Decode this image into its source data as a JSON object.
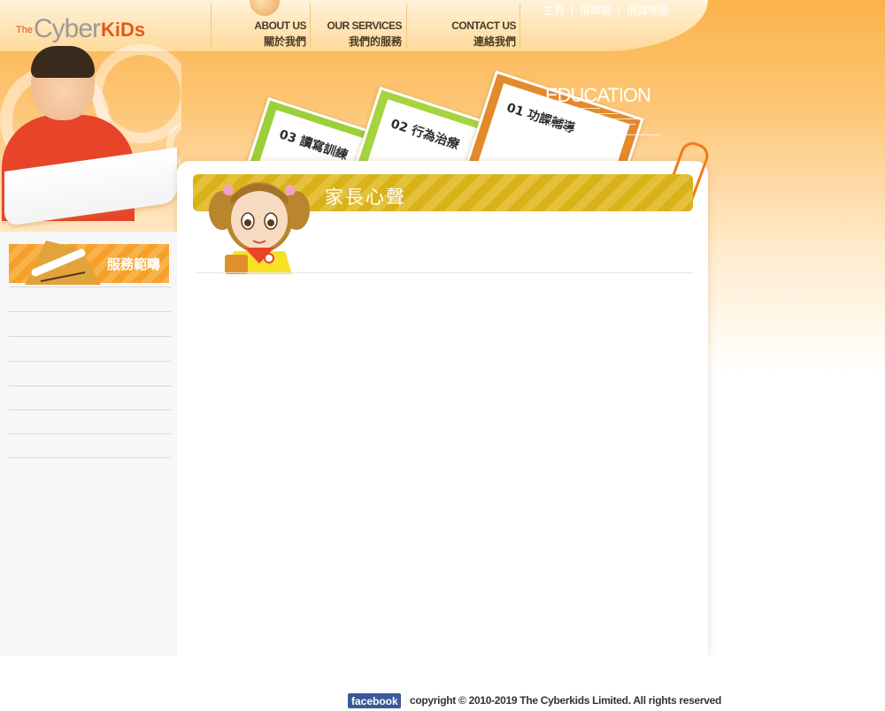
{
  "brand": {
    "the": "The",
    "cyber": "Cyber",
    "kids": "KiDs"
  },
  "nav": {
    "about": {
      "en": "ABOUT US",
      "zh": "關於我們"
    },
    "services": {
      "en": "OUR  SERVICES",
      "zh": "我們的服務"
    },
    "contact": {
      "en": "CONTACT US",
      "zh": "連絡我們"
    }
  },
  "util_links": [
    "主頁",
    "招聘欄",
    "網頁地圖"
  ],
  "tabs": [
    {
      "label": "03 讀寫訓練",
      "color": "#9ccf3a"
    },
    {
      "label": "02 行為治療",
      "color": "#a6d43f"
    },
    {
      "label": "01 功課輔導",
      "color": "#e38a2c"
    }
  ],
  "education": {
    "title": "EDUCATION"
  },
  "page_banner": {
    "title": "家長心聲"
  },
  "sidebar": {
    "heading": "服務範疇",
    "items": [
      "",
      "",
      "",
      "",
      "",
      "",
      ""
    ]
  },
  "footer": {
    "facebook": "facebook",
    "copyright": "copyright © 2010-2019 The Cyberkids Limited. All rights reserved"
  },
  "colors": {
    "accent_orange": "#f7a43a",
    "banner_gold": "#d9b21a"
  }
}
